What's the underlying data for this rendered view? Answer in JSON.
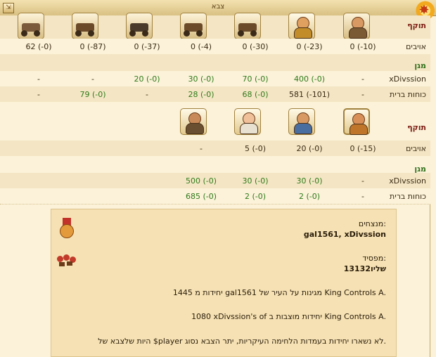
{
  "window": {
    "title": "צבא",
    "collapse_icon": "collapse-arrow-icon",
    "corner_icon": "explosion-icon"
  },
  "battle1": {
    "attacker_label": "תוקף",
    "units": [
      "catapult-unit-icon",
      "cart-unit-icon",
      "cannon-unit-icon",
      "battering-ram-unit-icon",
      "archer-unit-icon",
      "warrior-unit-icon",
      "soldier-unit-icon"
    ],
    "enemy_row": {
      "label": "אויבים",
      "cells": [
        "0 (-10)",
        "0 (-23)",
        "0 (-30)",
        "0 (-4)",
        "0 (-37)",
        "0 (-87)",
        "62 (-0)"
      ]
    },
    "defender_label": "מגן",
    "defender_rows": [
      {
        "label": "xDivssion",
        "cells": [
          "-",
          "400 (-0)",
          "70 (-0)",
          "30 (-0)",
          "20 (-0)",
          "-",
          "-"
        ],
        "colors": [
          "dark",
          "green",
          "green",
          "green",
          "green",
          "dark",
          "dark"
        ]
      },
      {
        "label": "כוחות ברית",
        "cells": [
          "-",
          "581 (-101)",
          "68 (-0)",
          "28 (-0)",
          "-",
          "79 (-0)",
          "-"
        ],
        "colors": [
          "dark",
          "dark",
          "green",
          "green",
          "dark",
          "green",
          "dark"
        ]
      }
    ]
  },
  "battle2": {
    "attacker_label": "תוקף",
    "units": [
      "hero-unit-icon",
      "spearman-unit-icon",
      "scholar-unit-icon",
      "brute-unit-icon"
    ],
    "enemy_row": {
      "label": "אויבים",
      "cells": [
        "0 (-15)",
        "20 (-0)",
        "5 (-0)",
        "-"
      ]
    },
    "defender_label": "מגן",
    "defender_rows": [
      {
        "label": "xDivssion",
        "cells": [
          "-",
          "30 (-0)",
          "30 (-0)",
          "500 (-0)"
        ],
        "colors": [
          "dark",
          "green",
          "green",
          "green"
        ]
      },
      {
        "label": "כוחות ברית",
        "cells": [
          "-",
          "2 (-0)",
          "2 (-0)",
          "685 (-0)"
        ],
        "colors": [
          "dark",
          "green",
          "green",
          "green"
        ]
      }
    ]
  },
  "report": {
    "winners_label": "מנצחים:",
    "winners": "gal1561, xDivssion",
    "loser_label": "מפסיד:",
    "loser": "שליו13132",
    "line1": "1445 יחידות מ gal1561 מגינות על העיר של King Controls A.",
    "line2": "1080 xDivssion's of יחידות מוצבות ב King Controls A.",
    "line3": "היות שלצבא של $player לא נשארו יחידות בעמדות הלחימה העיקריות, יתר הצבא נסוג.",
    "medal_icon": "medal-icon",
    "loser_icon": "defeated-units-icon"
  },
  "colors": {
    "background": "#fbf2d9",
    "alt_row": "#f4e6c4",
    "green_text": "#2f7a1a",
    "attacker_title": "#7a1a10"
  }
}
